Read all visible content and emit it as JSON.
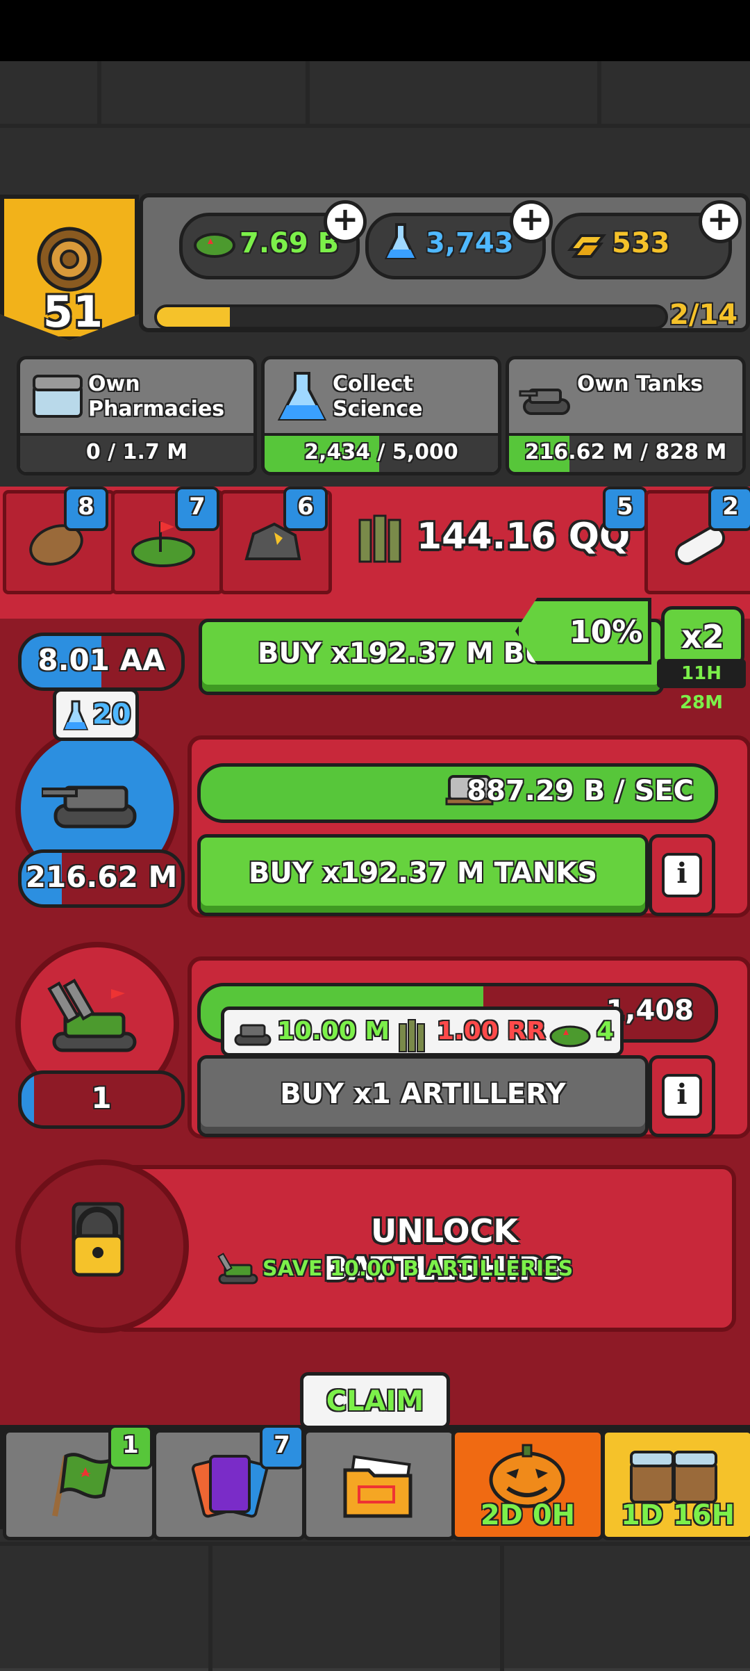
{
  "level": {
    "number": "51"
  },
  "currencies": [
    {
      "name": "cash",
      "value": "7.69 B",
      "icon": "army-cap-icon",
      "color": "#7cf04a"
    },
    {
      "name": "science",
      "value": "3,743",
      "icon": "flask-icon",
      "color": "#4fb8ff"
    },
    {
      "name": "gold",
      "value": "533",
      "icon": "gold-bars-icon",
      "color": "#f5c22a"
    }
  ],
  "level_progress": {
    "text": "2/14",
    "fraction": 0.143
  },
  "goals": [
    {
      "label_line1": "Own",
      "label_line2": "Pharmacies",
      "progress_text": "0 / 1.7 M",
      "fraction": 0.0,
      "icon": "pharmacy-chest-icon"
    },
    {
      "label_line1": "Collect",
      "label_line2": "Science",
      "progress_text": "2,434 / 5,000",
      "fraction": 0.49,
      "icon": "flask-icon"
    },
    {
      "label_line1": "Own Tanks",
      "label_line2": "",
      "progress_text": "216.62 M / 828 M",
      "fraction": 0.26,
      "icon": "tank-icon"
    }
  ],
  "resources": [
    {
      "icon": "potato-icon",
      "badge": "8"
    },
    {
      "icon": "field-flag-icon",
      "badge": "7"
    },
    {
      "icon": "ore-icon",
      "badge": "6"
    },
    {
      "icon": "pill-icon",
      "badge": "2"
    }
  ],
  "ammo": {
    "value": "144.16 QQ",
    "badge": "5"
  },
  "bunker_row": {
    "count": "8.01 AA",
    "buy_label": "BUY x192.37 M BUN",
    "discount": "10%",
    "boost": "x2",
    "boost_timer": "11H 28M"
  },
  "tanks_row": {
    "science_badge": "20",
    "count": "216.62 M",
    "count_fraction": 0.25,
    "rate": "887.29 B / SEC",
    "buy_label": "BUY x192.37 M TANKS",
    "info": "i"
  },
  "artillery_row": {
    "count": "1",
    "count_fraction": 0.08,
    "rate": "1,408",
    "rate_fraction": 0.55,
    "buy_label": "BUY x1 ARTILLERY",
    "info": "i",
    "cost_tanks": "10.00 M",
    "cost_ammo": "1.00 RR",
    "cost_cash": "4"
  },
  "battleships": {
    "title": "UNLOCK BATTLESHIPS",
    "subtitle": "SAVE 10.00 B ARTILLERIES"
  },
  "bottom_nav": {
    "missions_badge": "1",
    "cards_badge": "7",
    "claim_label": "CLAIM",
    "event_timer": "2D 0H",
    "chest_timer": "1D 16H"
  }
}
